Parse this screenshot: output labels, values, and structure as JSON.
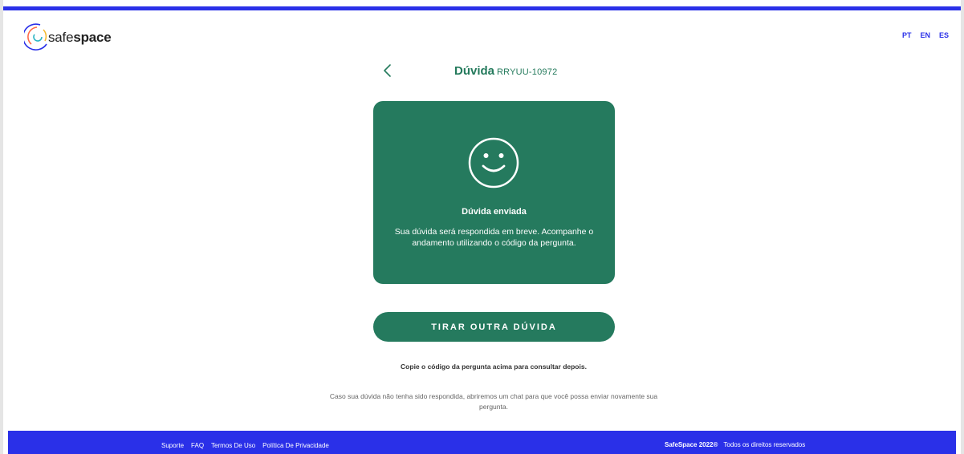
{
  "header": {
    "logo_text_light": "safe",
    "logo_text_bold": "space",
    "languages": [
      "PT",
      "EN",
      "ES"
    ]
  },
  "title": {
    "label": "Dúvida",
    "code": "RRYUU-10972"
  },
  "card": {
    "icon": "smiley-face-icon",
    "heading": "Dúvida enviada",
    "message": "Sua dúvida será respondida em breve. Acompanhe o andamento utilizando o código da pergunta."
  },
  "cta": {
    "label": "TIRAR OUTRA DÚVIDA"
  },
  "hints": {
    "copy": "Copie o código da pergunta acima para consultar depois.",
    "chat": "Caso sua dúvida não tenha sido respondida, abriremos um chat para que você possa enviar novamente sua pergunta."
  },
  "footer": {
    "links": [
      "Suporte",
      "FAQ",
      "Termos De Uso",
      "Política De Privacidade"
    ],
    "brand": "SafeSpace 2022®",
    "rights": "Todos os direitos reservados"
  },
  "colors": {
    "brand_blue": "#2a30e8",
    "green": "#257a5e"
  }
}
